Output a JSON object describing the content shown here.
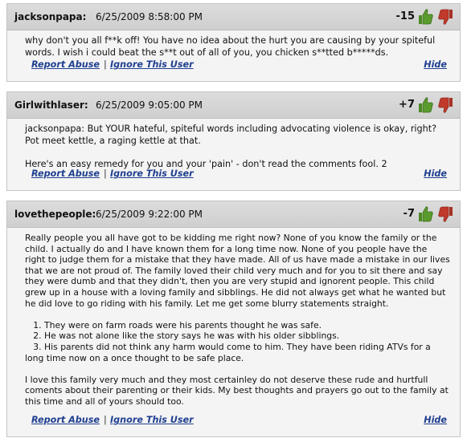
{
  "comments": [
    {
      "author": "jacksonpapa:",
      "date": "6/25/2009 8:58:00 PM",
      "score": "-15",
      "body": "why don't you all f**k off! You have no idea about the hurt you are causing by your spiteful words. I wish i could beat the s**t out of all of you, you chicken s**tted b*****ds.",
      "report_label": "Report Abuse",
      "separator": "|",
      "ignore_label": "Ignore This User",
      "hide_label": "Hide"
    },
    {
      "author": "Girlwithlaser:",
      "date": "6/25/2009 9:05:00 PM",
      "score": "+7",
      "body": "jacksonpapa: But YOUR hateful, spiteful words including advocating violence is okay, right? Pot meet kettle, a raging kettle at that.\n\nHere's an easy remedy for you and your 'pain' - don't read the comments fool. 2",
      "report_label": "Report Abuse",
      "separator": "|",
      "ignore_label": "Ignore This User",
      "hide_label": "Hide"
    },
    {
      "author": "lovethepeople:",
      "date": "6/25/2009 9:22:00 PM",
      "score": "-7",
      "body": "Really people you all have got to be kidding me right now? None of you know the family or the child. I actually do and I have known them for a long time now. None of you people have the right to judge them for a mistake that they have made. All of us have made a mistake in our lives that we are not proud of. The family loved their child very much and for you to sit there and say they were dumb and that they didn't, then you are very stupid and ignorent people. This child grew up in a house with a loving family and sibblings. He did not always get what he wanted but he did love to go riding with his family. Let me get some blurry statements straight.\n\n   1. They were on farm roads were his parents thought he was safe.\n   2. He was not alone like the story says he was with his older sibblings.\n   3. His parents did not think any harm would come to him. They have been riding ATVs for a long time now on a once thought to be safe place.\n\nI love this family very much and they most certainley do not deserve these rude and hurtfull coments about their parenting or their kids. My best thoughts and prayers go out to the family at this time and all of yours should too.",
      "report_label": "Report Abuse",
      "separator": "|",
      "ignore_label": "Ignore This User",
      "hide_label": "Hide"
    }
  ],
  "icons": {
    "thumbs_up_color": "#5a9b2e",
    "thumbs_down_color": "#c0392b"
  }
}
